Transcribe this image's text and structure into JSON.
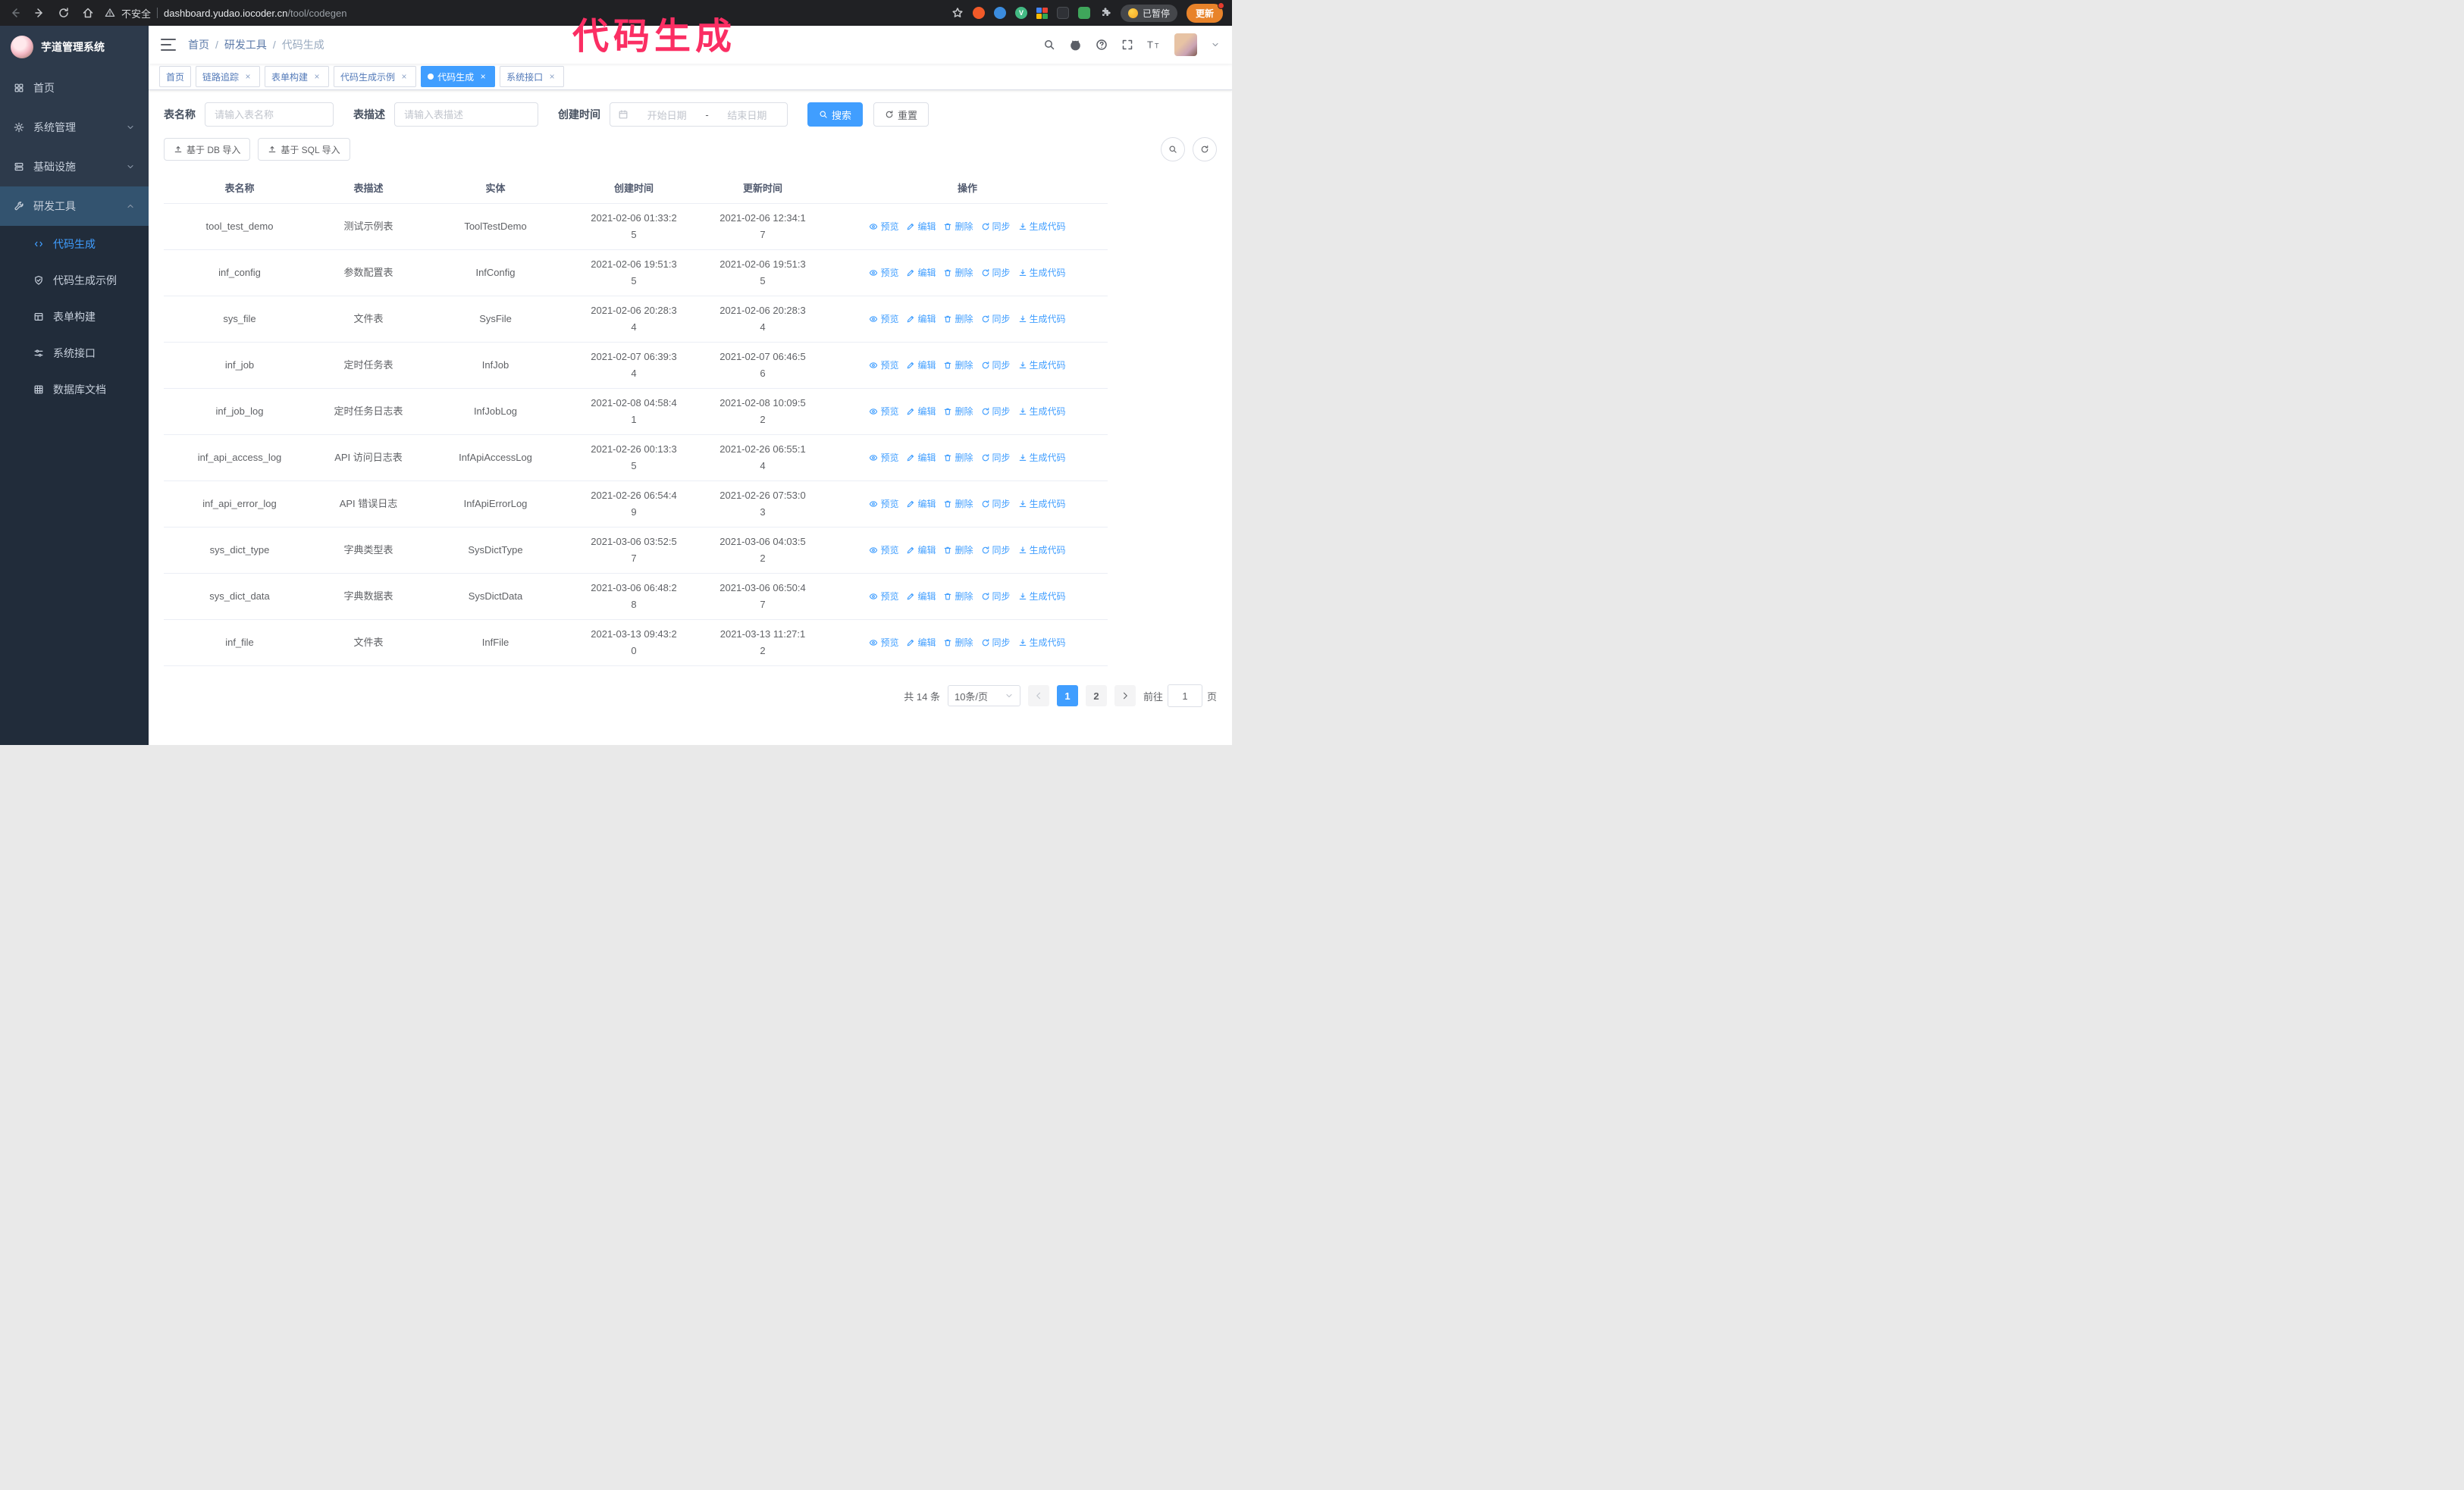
{
  "colors": {
    "accent": "#409eff",
    "annotation": "#fb2e63",
    "sidebar_bg": "#2d3a4b",
    "chrome_bg": "#202124"
  },
  "icons": {
    "back-icon": "left arrow",
    "forward-icon": "right arrow",
    "reload-icon": "circular arrow",
    "home-icon": "house",
    "warning-icon": "triangle exclamation",
    "star-icon": "bookmark star",
    "puzzle-icon": "extensions puzzle piece",
    "hamburger-icon": "menu lines",
    "search-icon": "magnifier",
    "github-icon": "octocat",
    "help-icon": "question circle",
    "fullscreen-icon": "expand corners",
    "font-size-icon": "two T letters",
    "chevron-down-icon": "caret",
    "calendar-icon": "calendar",
    "refresh-icon": "circular arrow",
    "upload-icon": "arrow up over line",
    "eye-icon": "eye",
    "pencil-icon": "pencil",
    "trash-icon": "trash can",
    "download-icon": "arrow down over line",
    "code-icon": "angle brackets",
    "gear-icon": "gear",
    "dashboard-icon": "four squares",
    "server-icon": "stacked servers",
    "wrench-icon": "wrench",
    "shield-icon": "shield check",
    "form-icon": "table grid",
    "sliders-icon": "lines with knobs",
    "grid-icon": "3x3 grid"
  },
  "browser": {
    "security_warning": "不安全",
    "url_domain": "dashboard.yudao.iocoder.cn",
    "url_path": "/tool/codegen",
    "paused_badge": "已暂停",
    "update_button": "更新"
  },
  "annotation": {
    "text": "代码生成"
  },
  "sidebar": {
    "logo_title": "芋道管理系统",
    "items": [
      {
        "label": "首页"
      },
      {
        "label": "系统管理"
      },
      {
        "label": "基础设施"
      },
      {
        "label": "研发工具"
      }
    ],
    "submenu": [
      {
        "label": "代码生成",
        "active": true
      },
      {
        "label": "代码生成示例"
      },
      {
        "label": "表单构建"
      },
      {
        "label": "系统接口"
      },
      {
        "label": "数据库文档"
      }
    ]
  },
  "header": {
    "breadcrumb": [
      "首页",
      "研发工具",
      "代码生成"
    ],
    "breadcrumb_separator": "/"
  },
  "tabs": [
    {
      "label": "首页",
      "closable": false,
      "active": false
    },
    {
      "label": "链路追踪",
      "closable": true,
      "active": false
    },
    {
      "label": "表单构建",
      "closable": true,
      "active": false
    },
    {
      "label": "代码生成示例",
      "closable": true,
      "active": false
    },
    {
      "label": "代码生成",
      "closable": true,
      "active": true
    },
    {
      "label": "系统接口",
      "closable": true,
      "active": false
    }
  ],
  "filters": {
    "table_name_label": "表名称",
    "table_name_placeholder": "请输入表名称",
    "table_desc_label": "表描述",
    "table_desc_placeholder": "请输入表描述",
    "create_time_label": "创建时间",
    "date_start_placeholder": "开始日期",
    "date_separator": "-",
    "date_end_placeholder": "结束日期",
    "search_button": "搜索",
    "reset_button": "重置"
  },
  "toolbar": {
    "import_db_button": "基于 DB 导入",
    "import_sql_button": "基于 SQL 导入"
  },
  "table": {
    "columns": [
      "表名称",
      "表描述",
      "实体",
      "创建时间",
      "更新时间",
      "操作"
    ],
    "actions": [
      "预览",
      "编辑",
      "删除",
      "同步",
      "生成代码"
    ],
    "rows": [
      {
        "name": "tool_test_demo",
        "desc": "测试示例表",
        "entity": "ToolTestDemo",
        "created": "2021-02-06 01:33:25",
        "updated": "2021-02-06 12:34:17"
      },
      {
        "name": "inf_config",
        "desc": "参数配置表",
        "entity": "InfConfig",
        "created": "2021-02-06 19:51:35",
        "updated": "2021-02-06 19:51:35"
      },
      {
        "name": "sys_file",
        "desc": "文件表",
        "entity": "SysFile",
        "created": "2021-02-06 20:28:34",
        "updated": "2021-02-06 20:28:34"
      },
      {
        "name": "inf_job",
        "desc": "定时任务表",
        "entity": "InfJob",
        "created": "2021-02-07 06:39:34",
        "updated": "2021-02-07 06:46:56"
      },
      {
        "name": "inf_job_log",
        "desc": "定时任务日志表",
        "entity": "InfJobLog",
        "created": "2021-02-08 04:58:41",
        "updated": "2021-02-08 10:09:52"
      },
      {
        "name": "inf_api_access_log",
        "desc": "API 访问日志表",
        "entity": "InfApiAccessLog",
        "created": "2021-02-26 00:13:35",
        "updated": "2021-02-26 06:55:14"
      },
      {
        "name": "inf_api_error_log",
        "desc": "API 错误日志",
        "entity": "InfApiErrorLog",
        "created": "2021-02-26 06:54:49",
        "updated": "2021-02-26 07:53:03"
      },
      {
        "name": "sys_dict_type",
        "desc": "字典类型表",
        "entity": "SysDictType",
        "created": "2021-03-06 03:52:57",
        "updated": "2021-03-06 04:03:52"
      },
      {
        "name": "sys_dict_data",
        "desc": "字典数据表",
        "entity": "SysDictData",
        "created": "2021-03-06 06:48:28",
        "updated": "2021-03-06 06:50:47"
      },
      {
        "name": "inf_file",
        "desc": "文件表",
        "entity": "InfFile",
        "created": "2021-03-13 09:43:20",
        "updated": "2021-03-13 11:27:12"
      }
    ]
  },
  "pagination": {
    "total_text": "共 14 条",
    "page_size": "10条/页",
    "pages": [
      "1",
      "2"
    ],
    "active_page": "1",
    "goto_label": "前往",
    "goto_value": "1",
    "goto_suffix": "页"
  }
}
